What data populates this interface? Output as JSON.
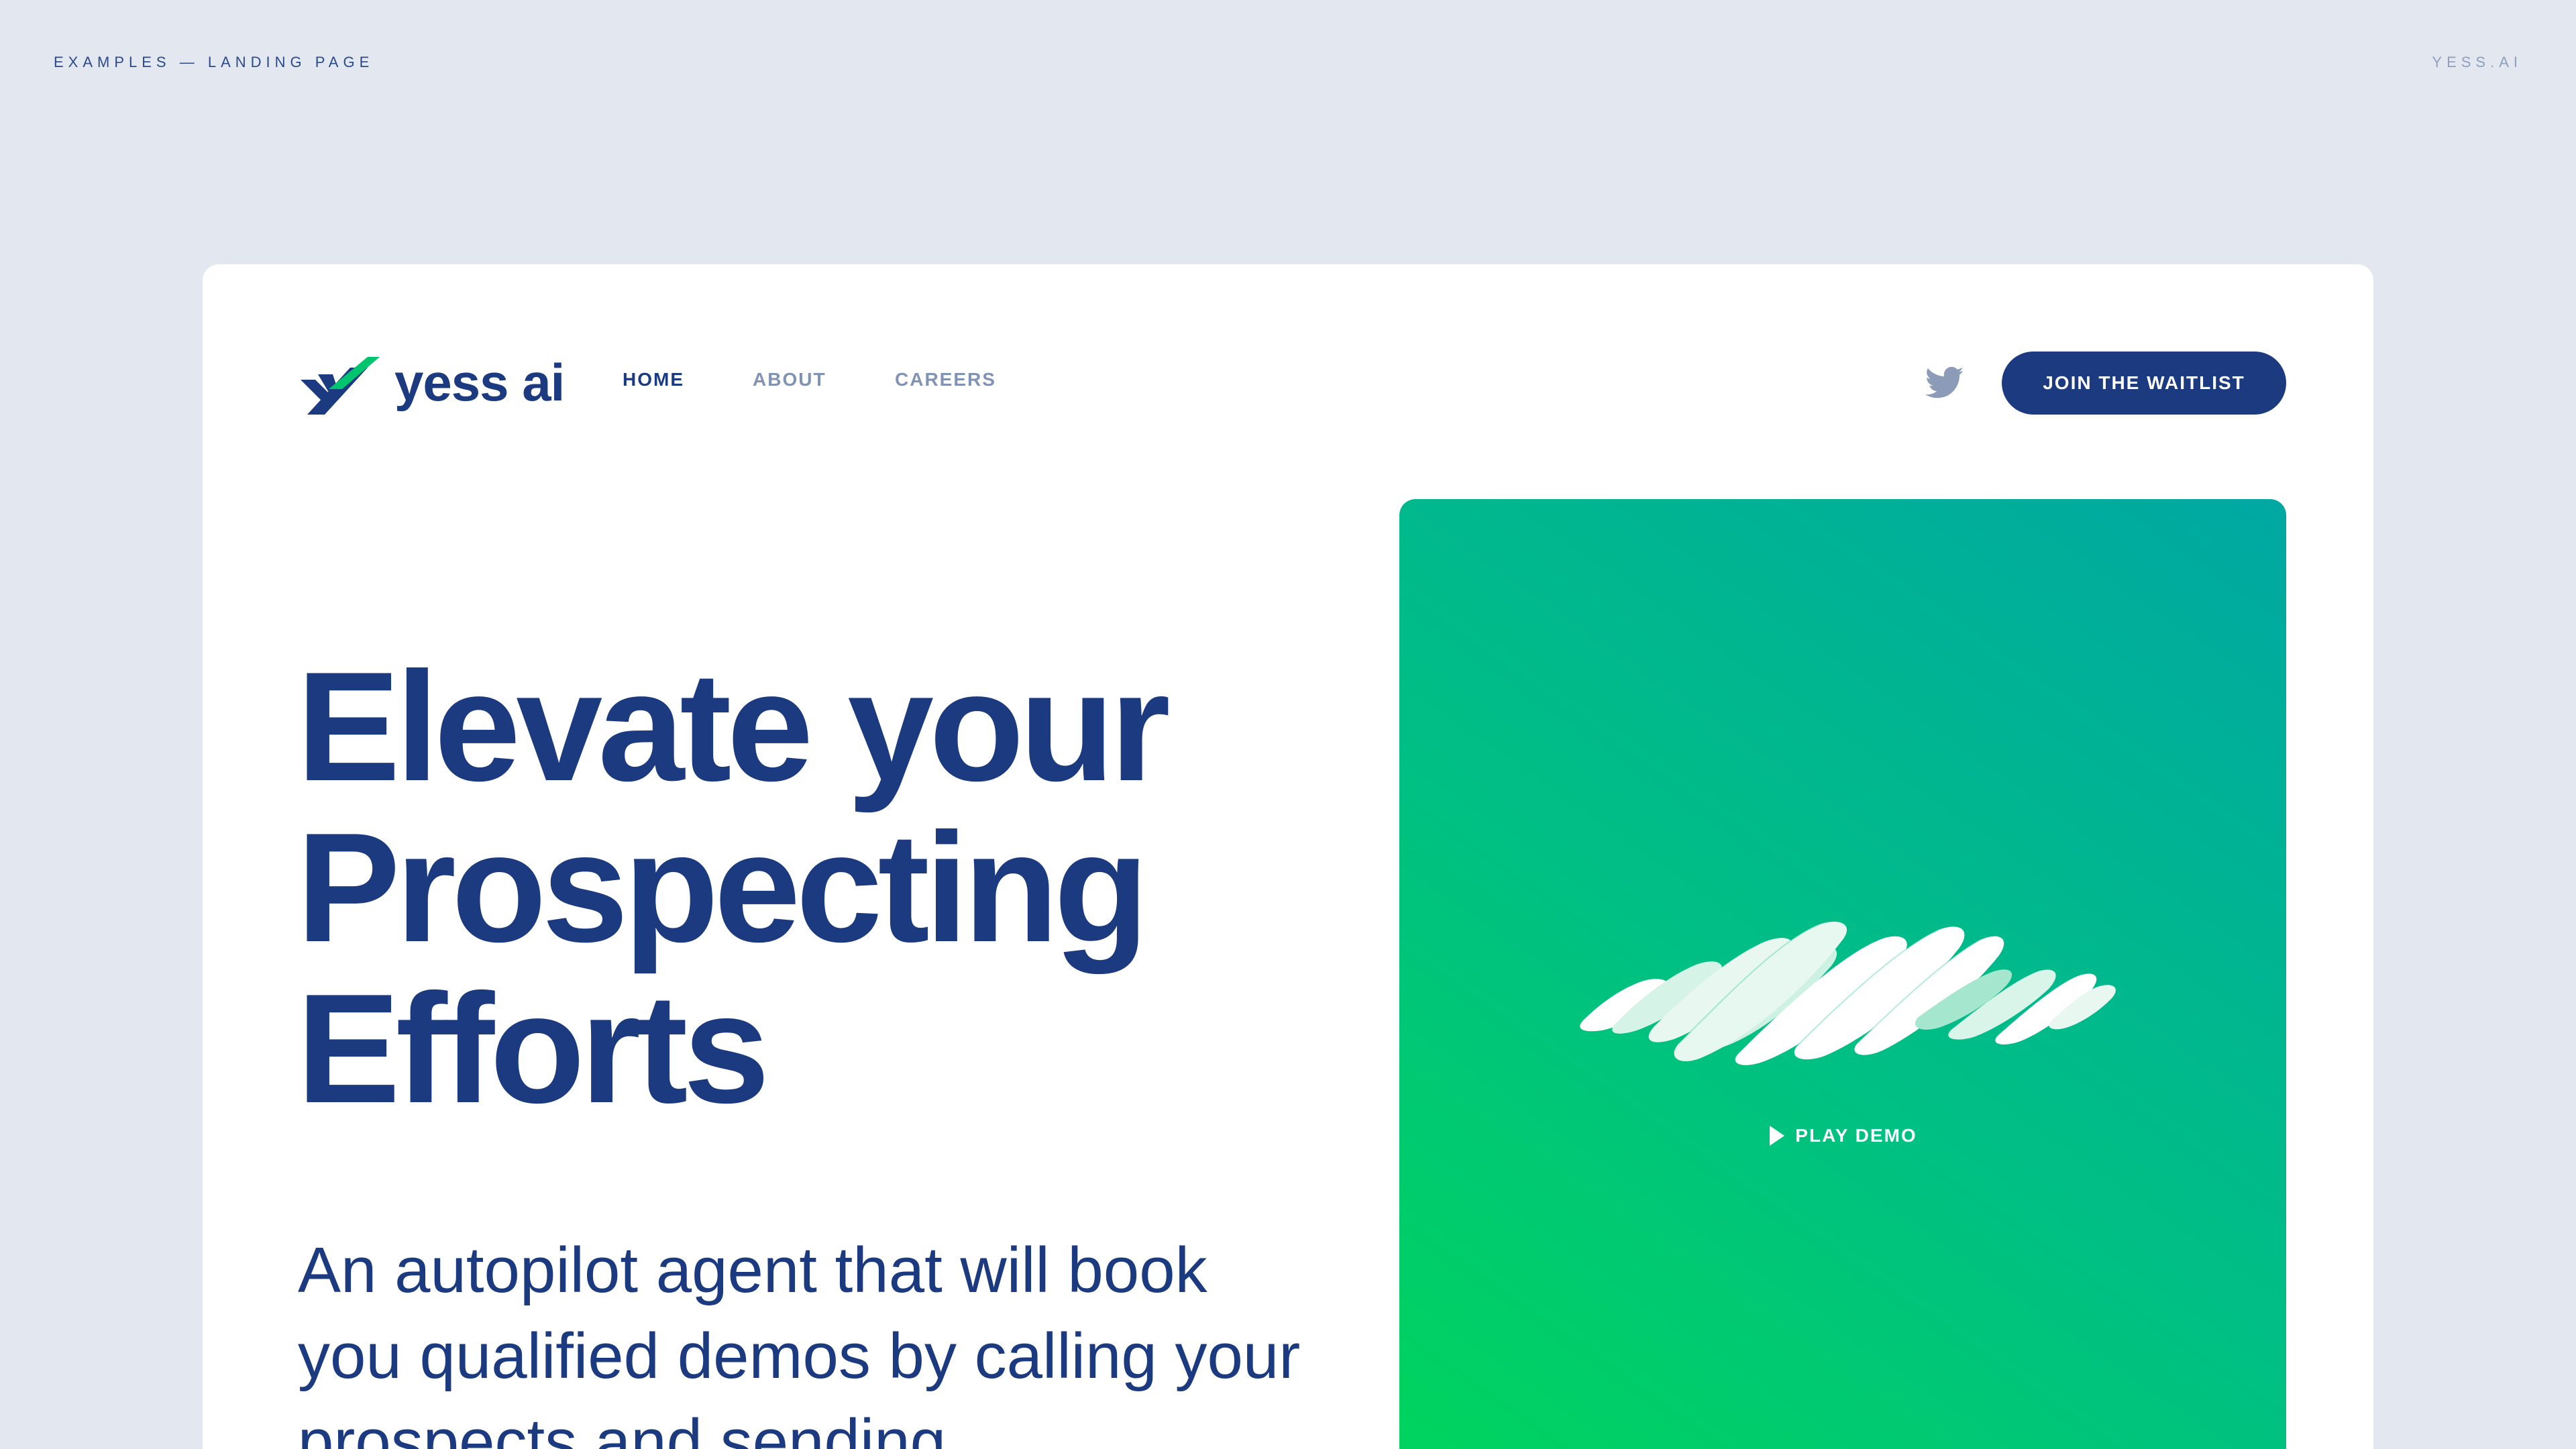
{
  "frame": {
    "left_label": "EXAMPLES — LANDING PAGE",
    "right_label": "YESS.AI"
  },
  "nav": {
    "logo_text": "yess ai",
    "items": [
      {
        "label": "HOME",
        "active": true
      },
      {
        "label": "ABOUT",
        "active": false
      },
      {
        "label": "CAREERS",
        "active": false
      }
    ],
    "social_icon": "twitter-icon",
    "cta_label": "JOIN THE WAITLIST"
  },
  "hero": {
    "title_lines": [
      "Elevate your",
      "Prospecting",
      "Efforts"
    ],
    "subtitle": "An autopilot agent that will book you qualified demos by calling your prospects and sending"
  },
  "demo": {
    "play_label": "PLAY DEMO",
    "play_icon": "play-icon"
  },
  "colors": {
    "background": "#e3e8f0",
    "brand_navy": "#1b3a80",
    "muted_nav": "#8193b5",
    "gradient_green": "#00d45e",
    "gradient_teal": "#00a8a2"
  }
}
